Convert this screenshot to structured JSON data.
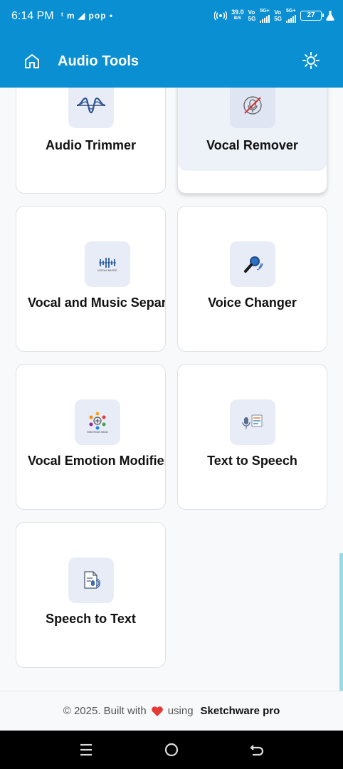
{
  "status_bar": {
    "time": "6:14 PM",
    "notifications": "ᵗ m ◢ pop •",
    "speed_value": "39.0",
    "speed_unit": "B/S",
    "net1_top": "Vo",
    "net1_bottom": "5G",
    "net1_type": "5G+",
    "net2_top": "Vo",
    "net2_bottom": "5G",
    "net2_type": "5G+",
    "battery": "27"
  },
  "app_bar": {
    "title": "Audio Tools",
    "home_icon": "home-icon",
    "theme_icon": "sun-icon"
  },
  "tools": [
    {
      "label": "Audio Trimmer",
      "icon": "waveform-icon"
    },
    {
      "label": "Vocal Remover",
      "icon": "no-vocal-icon"
    },
    {
      "label": "Vocal and Music Separ",
      "icon": "separator-icon",
      "icon_caption": "VOCAL MUSIC"
    },
    {
      "label": "Voice Changer",
      "icon": "microphone-icon"
    },
    {
      "label": "Vocal Emotion Modifier",
      "icon": "emotion-icon",
      "icon_caption": "EMOTION MOD"
    },
    {
      "label": "Text to Speech",
      "icon": "text-to-speech-icon"
    },
    {
      "label": "Speech to Text",
      "icon": "speech-to-text-icon"
    }
  ],
  "footer": {
    "prefix": "© 2025. Built with",
    "middle": "using",
    "brand": "Sketchware pro",
    "heart_color": "#e53935"
  },
  "colors": {
    "accent": "#0a8fd2",
    "icon_bg": "#e8ecf7"
  }
}
